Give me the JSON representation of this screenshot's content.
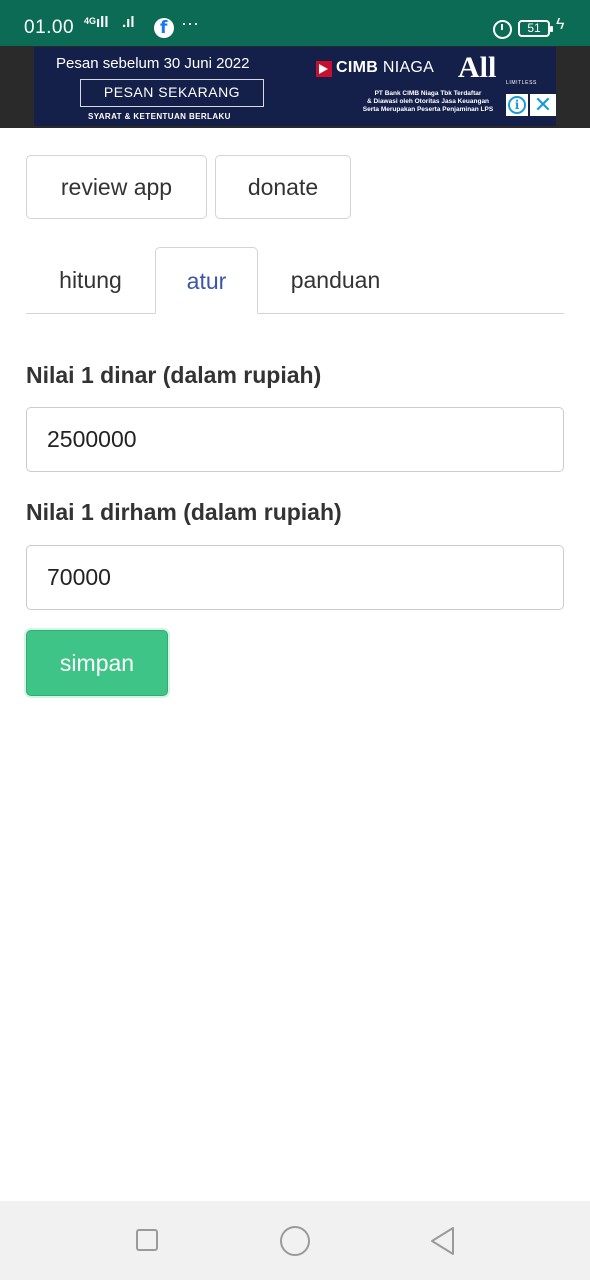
{
  "status_bar": {
    "time": "01.00",
    "network": "4G",
    "battery": "51",
    "icons": [
      "signal-icon",
      "facebook-icon",
      "more-icon",
      "alarm-icon",
      "battery-icon",
      "charging-icon"
    ]
  },
  "ad": {
    "headline": "Pesan sebelum 30 Juni 2022",
    "cta": "PESAN SEKARANG",
    "terms": "SYARAT & KETENTUAN BERLAKU",
    "brand_bold": "CIMB",
    "brand_light": "NIAGA",
    "brand_logo": "All",
    "brand_tagline": "LIMITLESS",
    "legal_1": "PT Bank CIMB Niaga Tbk Terdaftar",
    "legal_2": "& Diawasi oleh Otoritas Jasa Keuangan",
    "legal_3": "Serta Merupakan Peserta Penjaminan LPS",
    "info_glyph": "i",
    "close_glyph": "✕"
  },
  "buttons": {
    "review": "review app",
    "donate": "donate",
    "save": "simpan"
  },
  "tabs": [
    {
      "label": "hitung",
      "active": false
    },
    {
      "label": "atur",
      "active": true
    },
    {
      "label": "panduan",
      "active": false
    }
  ],
  "form": {
    "dinar_label": "Nilai 1 dinar (dalam rupiah)",
    "dinar_value": "2500000",
    "dirham_label": "Nilai 1 dirham (dalam rupiah)",
    "dirham_value": "70000"
  },
  "colors": {
    "status_bar": "#0b6b54",
    "ad_background": "#15204a",
    "active_tab": "#3c55a5",
    "save_button": "#3dc486"
  }
}
